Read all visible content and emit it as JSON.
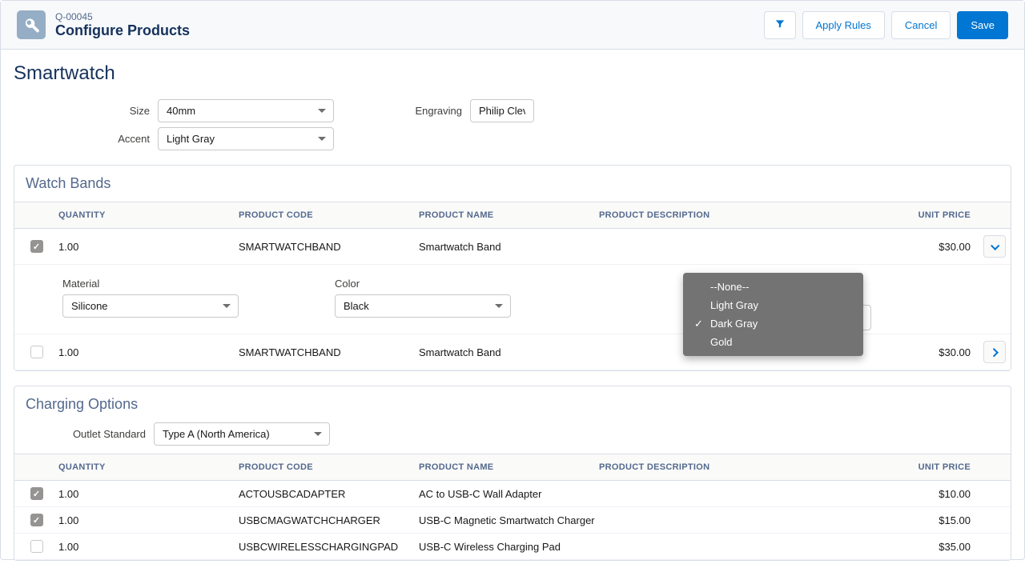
{
  "header": {
    "quote_id": "Q-00045",
    "title": "Configure Products",
    "apply_rules": "Apply Rules",
    "cancel": "Cancel",
    "save": "Save"
  },
  "product": {
    "title": "Smartwatch",
    "size_label": "Size",
    "size_value": "40mm",
    "accent_label": "Accent",
    "accent_value": "Light Gray",
    "engraving_label": "Engraving",
    "engraving_value": "Philip Cleve"
  },
  "columns": {
    "qty": "QUANTITY",
    "code": "PRODUCT CODE",
    "name": "PRODUCT NAME",
    "desc": "PRODUCT DESCRIPTION",
    "price": "UNIT PRICE"
  },
  "watch_bands": {
    "title": "Watch Bands",
    "rows": [
      {
        "checked": true,
        "qty": "1.00",
        "code": "SMARTWATCHBAND",
        "name": "Smartwatch Band",
        "desc": "",
        "price": "$30.00",
        "expanded": true
      },
      {
        "checked": false,
        "qty": "1.00",
        "code": "SMARTWATCHBAND",
        "name": "Smartwatch Band",
        "desc": "",
        "price": "$30.00",
        "expanded": false
      }
    ],
    "config": {
      "material_label": "Material",
      "material_value": "Silicone",
      "color_label": "Color",
      "color_value": "Black"
    }
  },
  "dropdown": {
    "options": [
      "--None--",
      "Light Gray",
      "Dark Gray",
      "Gold"
    ],
    "selected": "Dark Gray"
  },
  "charging": {
    "title": "Charging Options",
    "outlet_label": "Outlet Standard",
    "outlet_value": "Type A (North America)",
    "rows": [
      {
        "checked": true,
        "qty": "1.00",
        "code": "ACTOUSBCADAPTER",
        "name": "AC to USB-C Wall Adapter",
        "desc": "",
        "price": "$10.00"
      },
      {
        "checked": true,
        "qty": "1.00",
        "code": "USBCMAGWATCHCHARGER",
        "name": "USB-C Magnetic Smartwatch Charger",
        "desc": "",
        "price": "$15.00"
      },
      {
        "checked": false,
        "qty": "1.00",
        "code": "USBCWIRELESSCHARGINGPAD",
        "name": "USB-C Wireless Charging Pad",
        "desc": "",
        "price": "$35.00"
      }
    ]
  }
}
